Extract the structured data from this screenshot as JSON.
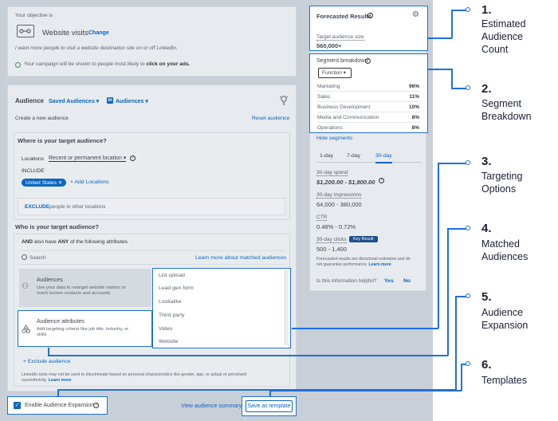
{
  "objective": {
    "header": "Your objective is",
    "name": "Website visits",
    "change_label": "Change",
    "description": "I want more people to visit a website destination site on or off LinkedIn.",
    "note_prefix": "Your campaign will be shown to people most likely to ",
    "note_bold": "click on your ads."
  },
  "audience": {
    "title": "Audience",
    "saved_audiences": "Saved Audiences ▾",
    "audiences_menu": "Audiences ▾",
    "create_new": "Create a new audience",
    "reset": "Reset audience",
    "where_q": "Where is your target audience?",
    "locations_label": "Locations",
    "locations_select": "Recent or permanent location ▾",
    "include_label": "INCLUDE",
    "location_pill": "United States ✕",
    "add_locations": "+ Add Locations",
    "exclude_label": "EXCLUDE",
    "exclude_text": "people in other locations",
    "who_q": "Who is your target audience?",
    "and_prefix": "AND",
    "and_mid": " also have ",
    "and_any": "ANY",
    "and_suffix": " of the following attributes",
    "search_placeholder": "Search",
    "learn_more_matched": "Learn more about matched audiences",
    "opt_audiences_title": "Audiences",
    "opt_audiences_desc1": "Use your data to retarget website visitors or",
    "opt_audiences_desc2": "reach known contacts and accounts",
    "opt_attrs_title": "Audience attributes",
    "opt_attrs_desc1": "Add targeting criteria like job title, industry, or",
    "opt_attrs_desc2": "skills",
    "dropdown_items": [
      "List upload",
      "Lead gen form",
      "Lookalike",
      "Third party",
      "Video",
      "Website"
    ],
    "exclude_audience": "+ Exclude audience",
    "disclaimer1": "LinkedIn tools may not be used to discriminate based on personal characteristics like gender, age, or actual or perceived",
    "disclaimer2": "race/ethnicity.",
    "disclaimer_link": "Learn more",
    "expansion_label": "Enable Audience Expansion",
    "view_summary": "View audience summary",
    "save_template": "Save as template"
  },
  "forecast": {
    "title": "Forecasted Results",
    "target_size_label": "Target audience size",
    "target_size_value": "560,000+",
    "segment_title": "Segment breakdown",
    "segment_select": "Function ▾",
    "segments": [
      {
        "name": "Marketing",
        "pct": "96%"
      },
      {
        "name": "Sales",
        "pct": "11%"
      },
      {
        "name": "Business Development",
        "pct": "10%"
      },
      {
        "name": "Media and Communication",
        "pct": "8%"
      },
      {
        "name": "Operations",
        "pct": "8%"
      }
    ],
    "hide_segments": "Hide segments",
    "tabs": [
      "1-day",
      "7-day",
      "30-day"
    ],
    "active_tab": "30-day",
    "spend_label": "30-day spend",
    "spend_value": "$1,200.00 - $1,800.00",
    "impr_label": "30-day impressions",
    "impr_value": "64,000 - 380,000",
    "ctr_label": "CTR",
    "ctr_value": "0.48% - 0.72%",
    "clicks_label": "30-day clicks",
    "clicks_badge": "Key Result",
    "clicks_value": "500 - 1,400",
    "footnote1": "Forecasted results are directional estimates and do",
    "footnote2": "not guarantee performance.",
    "footnote_link": "Learn more",
    "helpful_q": "Is this information helpful?",
    "yes": "Yes",
    "no": "No"
  },
  "callouts": [
    {
      "num": "1.",
      "label": "Estimated\nAudience\nCount"
    },
    {
      "num": "2.",
      "label": "Segment\nBreakdown"
    },
    {
      "num": "3.",
      "label": "Targeting\nOptions"
    },
    {
      "num": "4.",
      "label": "Matched\nAudiences"
    },
    {
      "num": "5.",
      "label": "Audience\nExpansion"
    },
    {
      "num": "6.",
      "label": "Templates"
    }
  ],
  "colors": {
    "accent": "#1f6fe0",
    "link": "#0a66c2",
    "shade": "#c9cfd7"
  }
}
